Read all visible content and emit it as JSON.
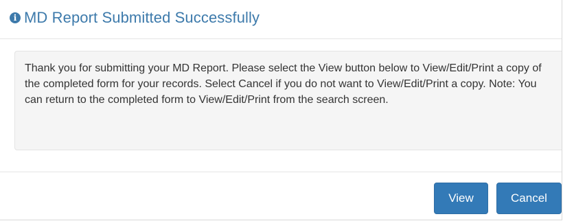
{
  "dialog": {
    "title": "MD Report Submitted Successfully",
    "icon": "info-circle-icon",
    "message": "Thank you for submitting your MD Report. Please select the View button below to View/Edit/Print a copy of the completed form for your records. Select Cancel if you do not want to View/Edit/Print a copy. Note: You can return to the completed form to View/Edit/Print from the search screen."
  },
  "footer": {
    "view_label": "View",
    "cancel_label": "Cancel"
  },
  "colors": {
    "title": "#3d7aab",
    "primary_button": "#337ab7",
    "well_background": "#f5f5f5"
  }
}
